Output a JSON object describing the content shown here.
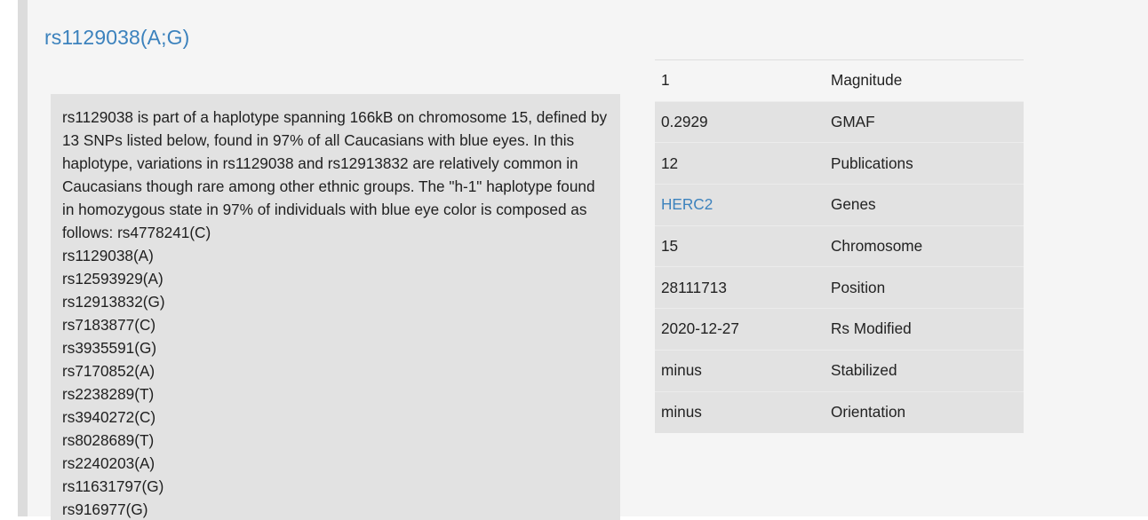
{
  "page": {
    "title": "rs1129038(A;G)"
  },
  "summary": {
    "text": "rs1129038 is part of a haplotype spanning 166kB on chromosome 15, defined by 13 SNPs listed below, found in 97% of all Caucasians with blue eyes. In this haplotype, variations in rs1129038 and rs12913832 are relatively common in Caucasians though rare among other ethnic groups. The \"h-1\" haplotype found in homozygous state in 97% of individuals with blue eye color is composed as follows: rs4778241(C)",
    "snps": [
      "rs1129038(A)",
      "rs12593929(A)",
      "rs12913832(G)",
      "rs7183877(C)",
      "rs3935591(G)",
      "rs7170852(A)",
      "rs2238289(T)",
      "rs3940272(C)",
      "rs8028689(T)",
      "rs2240203(A)",
      "rs11631797(G)",
      "rs916977(G)"
    ]
  },
  "info_table": {
    "rows": [
      {
        "value": "1",
        "label": "Magnitude"
      },
      {
        "value": "0.2929",
        "label": "GMAF"
      },
      {
        "value": "12",
        "label": "Publications"
      },
      {
        "value": "HERC2",
        "label": "Genes"
      },
      {
        "value": "15",
        "label": "Chromosome"
      },
      {
        "value": "28111713",
        "label": "Position"
      },
      {
        "value": "2020-12-27",
        "label": "Rs Modified"
      },
      {
        "value": "minus",
        "label": "Stabilized"
      },
      {
        "value": "minus",
        "label": "Orientation"
      }
    ]
  },
  "colors": {
    "link": "#3c82bd",
    "panel": "#e2e2e2",
    "background": "#f5f5f5",
    "left_border": "#dcdcdc"
  }
}
